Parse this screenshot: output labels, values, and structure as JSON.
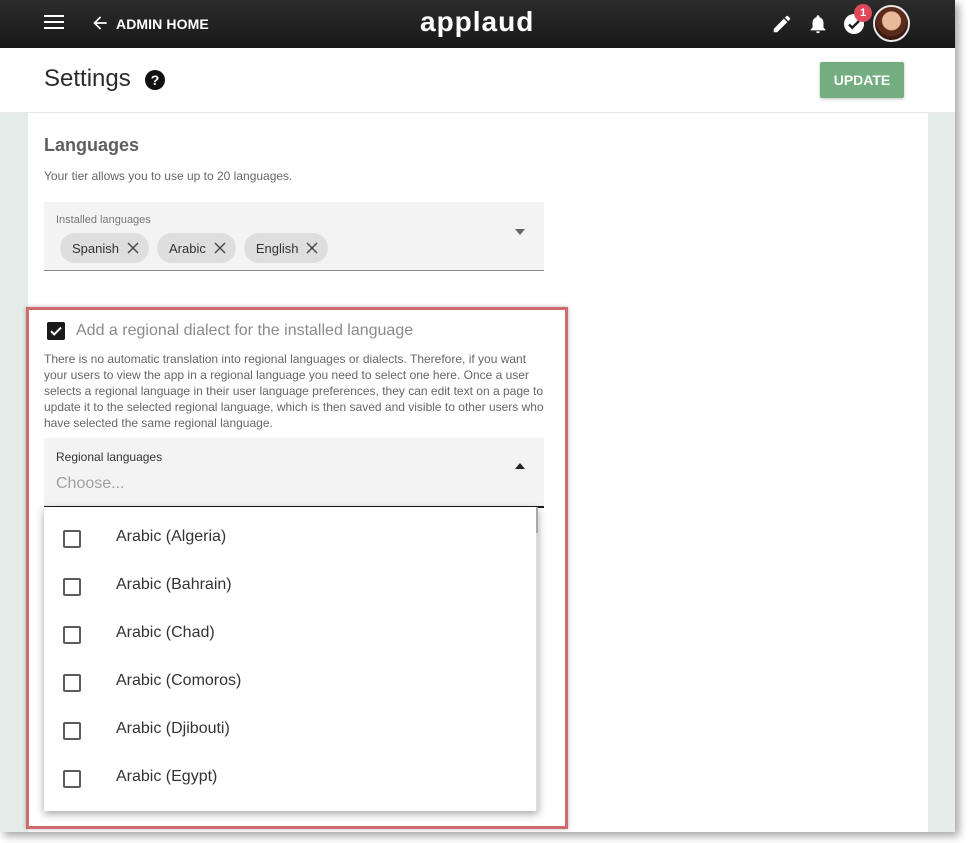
{
  "topbar": {
    "back_label": "ADMIN HOME",
    "logo_text": "applaud",
    "notification_badge": "1"
  },
  "header": {
    "title": "Settings",
    "help_glyph": "?",
    "update_label": "UPDATE"
  },
  "languages": {
    "heading": "Languages",
    "tier_text": "Your tier allows you to use up to 20 languages.",
    "installed_label": "Installed languages",
    "installed": [
      "Spanish",
      "Arabic",
      "English"
    ]
  },
  "dialect": {
    "checkbox_label": "Add a regional dialect for the installed language",
    "checked": true,
    "description": "There is no automatic translation into regional languages or dialects. Therefore, if you want your users to view the app in a regional language you need to select one here. Once a user selects a regional language in their user language preferences, they can edit text on a page to update it to the selected regional language, which is then saved and visible to other users who have selected the same regional language.",
    "regional_label": "Regional languages",
    "regional_placeholder": "Choose...",
    "options": [
      "Arabic (Algeria)",
      "Arabic (Bahrain)",
      "Arabic (Chad)",
      "Arabic (Comoros)",
      "Arabic (Djibouti)",
      "Arabic (Egypt)"
    ]
  },
  "colors": {
    "topbar": "#1e1e1e",
    "accent_button": "#74ad80",
    "highlight_border": "#d06a70",
    "badge": "#e0485a",
    "page_bg": "#e4ece9"
  },
  "icons": [
    "menu-icon",
    "back-arrow-icon",
    "pencil-icon",
    "bell-icon",
    "check-circle-icon",
    "help-icon",
    "close-icon",
    "caret-down-icon",
    "caret-up-icon",
    "checkbox-icon"
  ]
}
